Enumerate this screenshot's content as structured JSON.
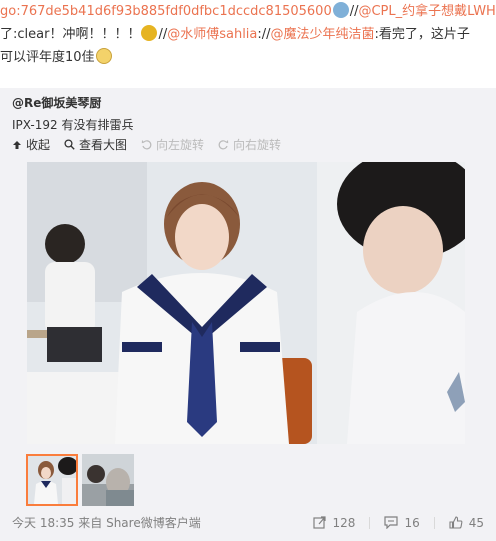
{
  "post": {
    "line1": {
      "hash": "go:767de5b41d6f93b885fdf0dfbc1dccdc81505600",
      "sep1": "//",
      "mention1": "@CPL_约拿子想戴LWH"
    },
    "line2": {
      "text1": "了:clear！冲啊！！！！",
      "sep": "//",
      "mention2": "@水师傅sahlia",
      "sep2": "://",
      "mention3": "@魔法少年纯洁菌",
      "text2": ":看完了，这片子"
    },
    "line3": {
      "text": "可以评年度10佳"
    }
  },
  "repost": {
    "author": "@Re御坂美琴厨",
    "text": "IPX-192 有没有排雷兵",
    "actions": [
      {
        "label": "收起",
        "icon": "collapse-icon",
        "enabled": true
      },
      {
        "label": "查看大图",
        "icon": "zoom-icon",
        "enabled": true
      },
      {
        "label": "向左旋转",
        "icon": "rotate-left-icon",
        "enabled": false
      },
      {
        "label": "向右旋转",
        "icon": "rotate-right-icon",
        "enabled": false
      }
    ]
  },
  "footer": {
    "time": "今天 18:35",
    "source_prefix": "来自",
    "source": "Share微博客户端",
    "reposts": "128",
    "comments": "16",
    "likes": "45"
  },
  "colors": {
    "accent": "#eb7350",
    "card_bg": "#f2f2f5",
    "thumb_border": "#fa7d3c"
  }
}
